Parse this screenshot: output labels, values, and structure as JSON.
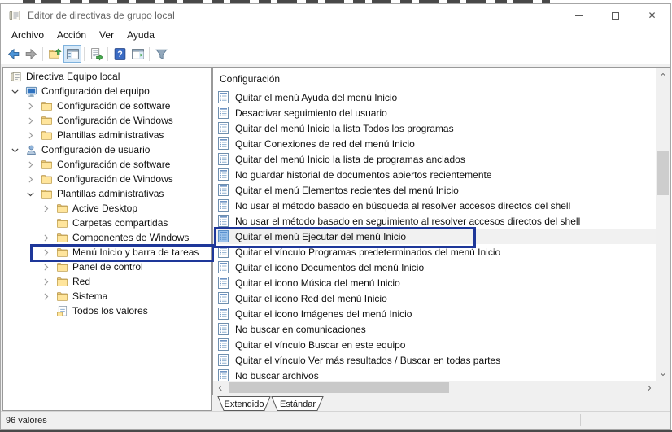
{
  "window": {
    "title": "Editor de directivas de grupo local",
    "app_icon": "gpedit-scroll-icon",
    "controls": [
      "minimize",
      "maximize",
      "close"
    ]
  },
  "menu": {
    "items": [
      "Archivo",
      "Acción",
      "Ver",
      "Ayuda"
    ]
  },
  "toolbar": {
    "items": [
      {
        "type": "icon",
        "icon": "back-arrow"
      },
      {
        "type": "icon",
        "icon": "forward-arrow"
      },
      {
        "type": "sep"
      },
      {
        "type": "icon",
        "icon": "up-one-level"
      },
      {
        "type": "icon",
        "icon": "show-console-tree",
        "active": true
      },
      {
        "type": "sep"
      },
      {
        "type": "icon",
        "icon": "export-list"
      },
      {
        "type": "sep"
      },
      {
        "type": "icon",
        "icon": "help"
      },
      {
        "type": "icon",
        "icon": "show-action-pane"
      },
      {
        "type": "sep"
      },
      {
        "type": "icon",
        "icon": "filter"
      }
    ]
  },
  "tree": {
    "items": [
      {
        "label": "Directiva Equipo local",
        "level": 0,
        "chev": "none",
        "icon": "gpedit-scroll"
      },
      {
        "label": "Configuración del equipo",
        "level": 0,
        "chev": "down",
        "icon": "computer"
      },
      {
        "label": "Configuración de software",
        "level": 1,
        "chev": "right",
        "icon": "folder"
      },
      {
        "label": "Configuración de Windows",
        "level": 1,
        "chev": "right",
        "icon": "folder"
      },
      {
        "label": "Plantillas administrativas",
        "level": 1,
        "chev": "right",
        "icon": "folder"
      },
      {
        "label": "Configuración de usuario",
        "level": 0,
        "chev": "down",
        "icon": "user"
      },
      {
        "label": "Configuración de software",
        "level": 1,
        "chev": "right",
        "icon": "folder"
      },
      {
        "label": "Configuración de Windows",
        "level": 1,
        "chev": "right",
        "icon": "folder"
      },
      {
        "label": "Plantillas administrativas",
        "level": 1,
        "chev": "down",
        "icon": "folder"
      },
      {
        "label": "Active Desktop",
        "level": 2,
        "chev": "right",
        "icon": "folder"
      },
      {
        "label": "Carpetas compartidas",
        "level": 2,
        "chev": "spacer",
        "icon": "folder"
      },
      {
        "label": "Componentes de Windows",
        "level": 2,
        "chev": "right",
        "icon": "folder"
      },
      {
        "label": "Menú Inicio y barra de tareas",
        "level": 2,
        "chev": "right",
        "icon": "folder",
        "annotated": true
      },
      {
        "label": "Panel de control",
        "level": 2,
        "chev": "right",
        "icon": "folder"
      },
      {
        "label": "Red",
        "level": 2,
        "chev": "right",
        "icon": "folder"
      },
      {
        "label": "Sistema",
        "level": 2,
        "chev": "right",
        "icon": "folder"
      },
      {
        "label": "Todos los valores",
        "level": 2,
        "chev": "spacer",
        "icon": "all-values"
      }
    ]
  },
  "list": {
    "header": "Configuración",
    "selected_index": 9,
    "items": [
      "Quitar el menú Ayuda del menú Inicio",
      "Desactivar seguimiento del usuario",
      "Quitar del menú Inicio la lista Todos los programas",
      "Quitar Conexiones de red del menú Inicio",
      "Quitar del menú Inicio la lista de programas anclados",
      "No guardar historial de documentos abiertos recientemente",
      "Quitar el menú Elementos recientes del menú Inicio",
      "No usar el método basado en búsqueda al resolver accesos directos del shell",
      "No usar el método basado en seguimiento al resolver accesos directos del shell",
      "Quitar el menú Ejecutar del menú Inicio",
      "Quitar el vínculo Programas predeterminados del menú Inicio",
      "Quitar el icono Documentos del menú Inicio",
      "Quitar el icono Música del menú Inicio",
      "Quitar el icono Red del menú Inicio",
      "Quitar el icono Imágenes del menú Inicio",
      "No buscar en comunicaciones",
      "Quitar el vínculo Buscar en este equipo",
      "Quitar el vínculo Ver más resultados / Buscar en todas partes",
      "No buscar archivos"
    ]
  },
  "tabs": {
    "items": [
      {
        "label": "Extendido",
        "active": true
      },
      {
        "label": "Estándar",
        "active": false
      }
    ]
  },
  "status": {
    "left": "96 valores"
  },
  "colors": {
    "annotation": "#1e3799",
    "selection_bg": "#f1f1f1",
    "toolbar_active_bg": "#d5e8f8",
    "toolbar_active_border": "#7fb2dd"
  }
}
